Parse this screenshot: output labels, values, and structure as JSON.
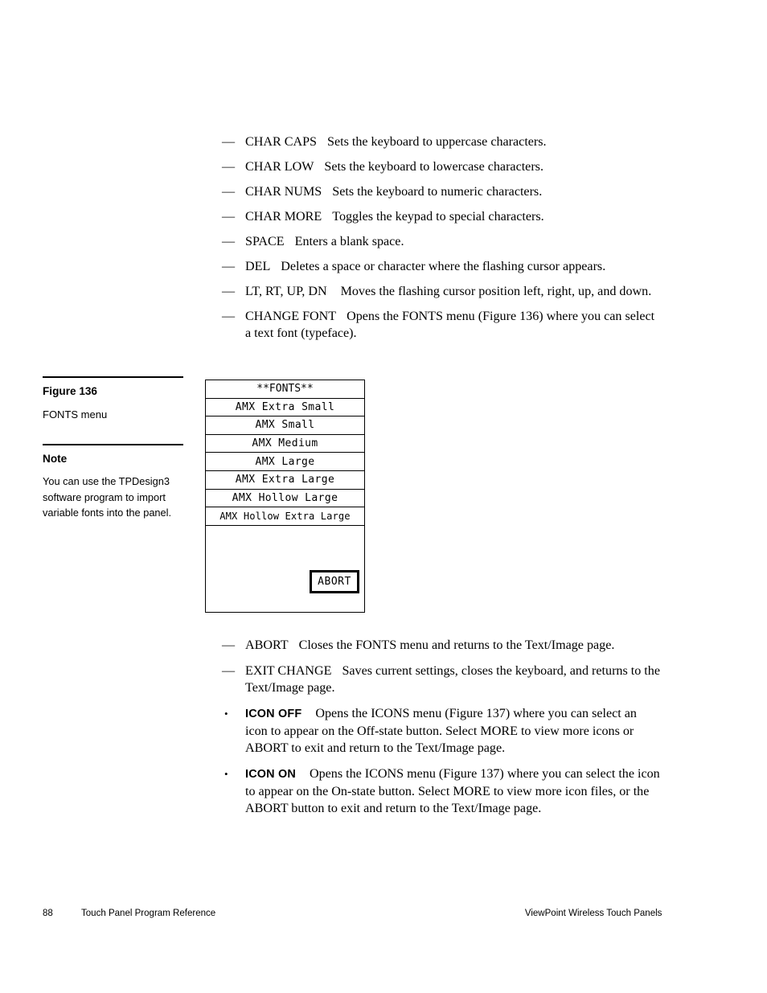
{
  "page": {
    "number": "88",
    "footer_left": "Touch Panel Program Reference",
    "footer_right": "ViewPoint Wireless Touch Panels"
  },
  "margin_column": {
    "figure_label": "Figure 136",
    "figure_caption": "FONTS menu",
    "note_label": "Note",
    "note_body": "You can use the TPDesign3 software program to import variable fonts into the panel."
  },
  "top_list": [
    {
      "marker": "—",
      "term": "CHAR CAPS",
      "description": "Sets the keyboard to uppercase characters."
    },
    {
      "marker": "—",
      "term": "CHAR LOW",
      "description": "Sets the keyboard to lowercase characters."
    },
    {
      "marker": "—",
      "term": "CHAR NUMS",
      "description": "Sets the keyboard to numeric characters."
    },
    {
      "marker": "—",
      "term": "CHAR MORE",
      "description": "Toggles the keypad to special characters."
    },
    {
      "marker": "—",
      "term": "SPACE",
      "description": "Enters a blank space."
    },
    {
      "marker": "—",
      "term": "DEL",
      "description": "Deletes a space or character where the flashing cursor appears."
    },
    {
      "marker": "—",
      "term": "LT, RT, UP, DN",
      "description": "Moves the flashing cursor position left, right, up, and down."
    },
    {
      "marker": "—",
      "term": "CHANGE FONT",
      "description": "Opens the FONTS menu (Figure 136) where you can select a text font (typeface)."
    }
  ],
  "bottom_list": [
    {
      "marker": "—",
      "term": "ABORT",
      "description": "Closes the FONTS menu and returns to the Text/Image page."
    },
    {
      "marker": "—",
      "term": "EXIT CHANGE",
      "description": "Saves current settings, closes the keyboard, and returns to the Text/Image page."
    },
    {
      "marker": "•",
      "term": "ICON OFF",
      "description": "Opens the ICONS menu (Figure 137) where you can select an icon to appear on the Off-state button. Select MORE to view more icons or ABORT to exit and return to the Text/Image page."
    },
    {
      "marker": "•",
      "term": "ICON ON",
      "description": "Opens the ICONS menu (Figure 137) where you can select the icon to appear on the On-state button. Select MORE to view more icon files, or the ABORT button to exit and return to the Text/Image page."
    }
  ],
  "fonts_menu": {
    "title": "**FONTS**",
    "items": [
      "AMX Extra Small",
      "AMX Small",
      "AMX Medium",
      "AMX Large",
      "AMX Extra Large",
      "AMX Hollow Large",
      "AMX Hollow Extra Large"
    ],
    "abort_label": "ABORT"
  }
}
